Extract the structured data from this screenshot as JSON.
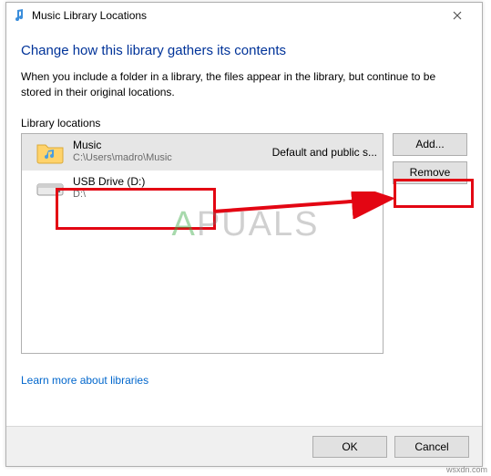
{
  "window": {
    "title": "Music Library Locations"
  },
  "heading": "Change how this library gathers its contents",
  "description": "When you include a folder in a library, the files appear in the library, but continue to be stored in their original locations.",
  "section_label": "Library locations",
  "locations": [
    {
      "name": "Music",
      "path": "C:\\Users\\madro\\Music",
      "status": "Default and public s..."
    },
    {
      "name": "USB Drive (D:)",
      "path": "D:\\",
      "status": ""
    }
  ],
  "buttons": {
    "add": "Add...",
    "remove": "Remove",
    "ok": "OK",
    "cancel": "Cancel"
  },
  "link": "Learn more about libraries",
  "watermark_a": "A",
  "watermark_b": "PUALS",
  "source_tag": "wsxdn.com"
}
